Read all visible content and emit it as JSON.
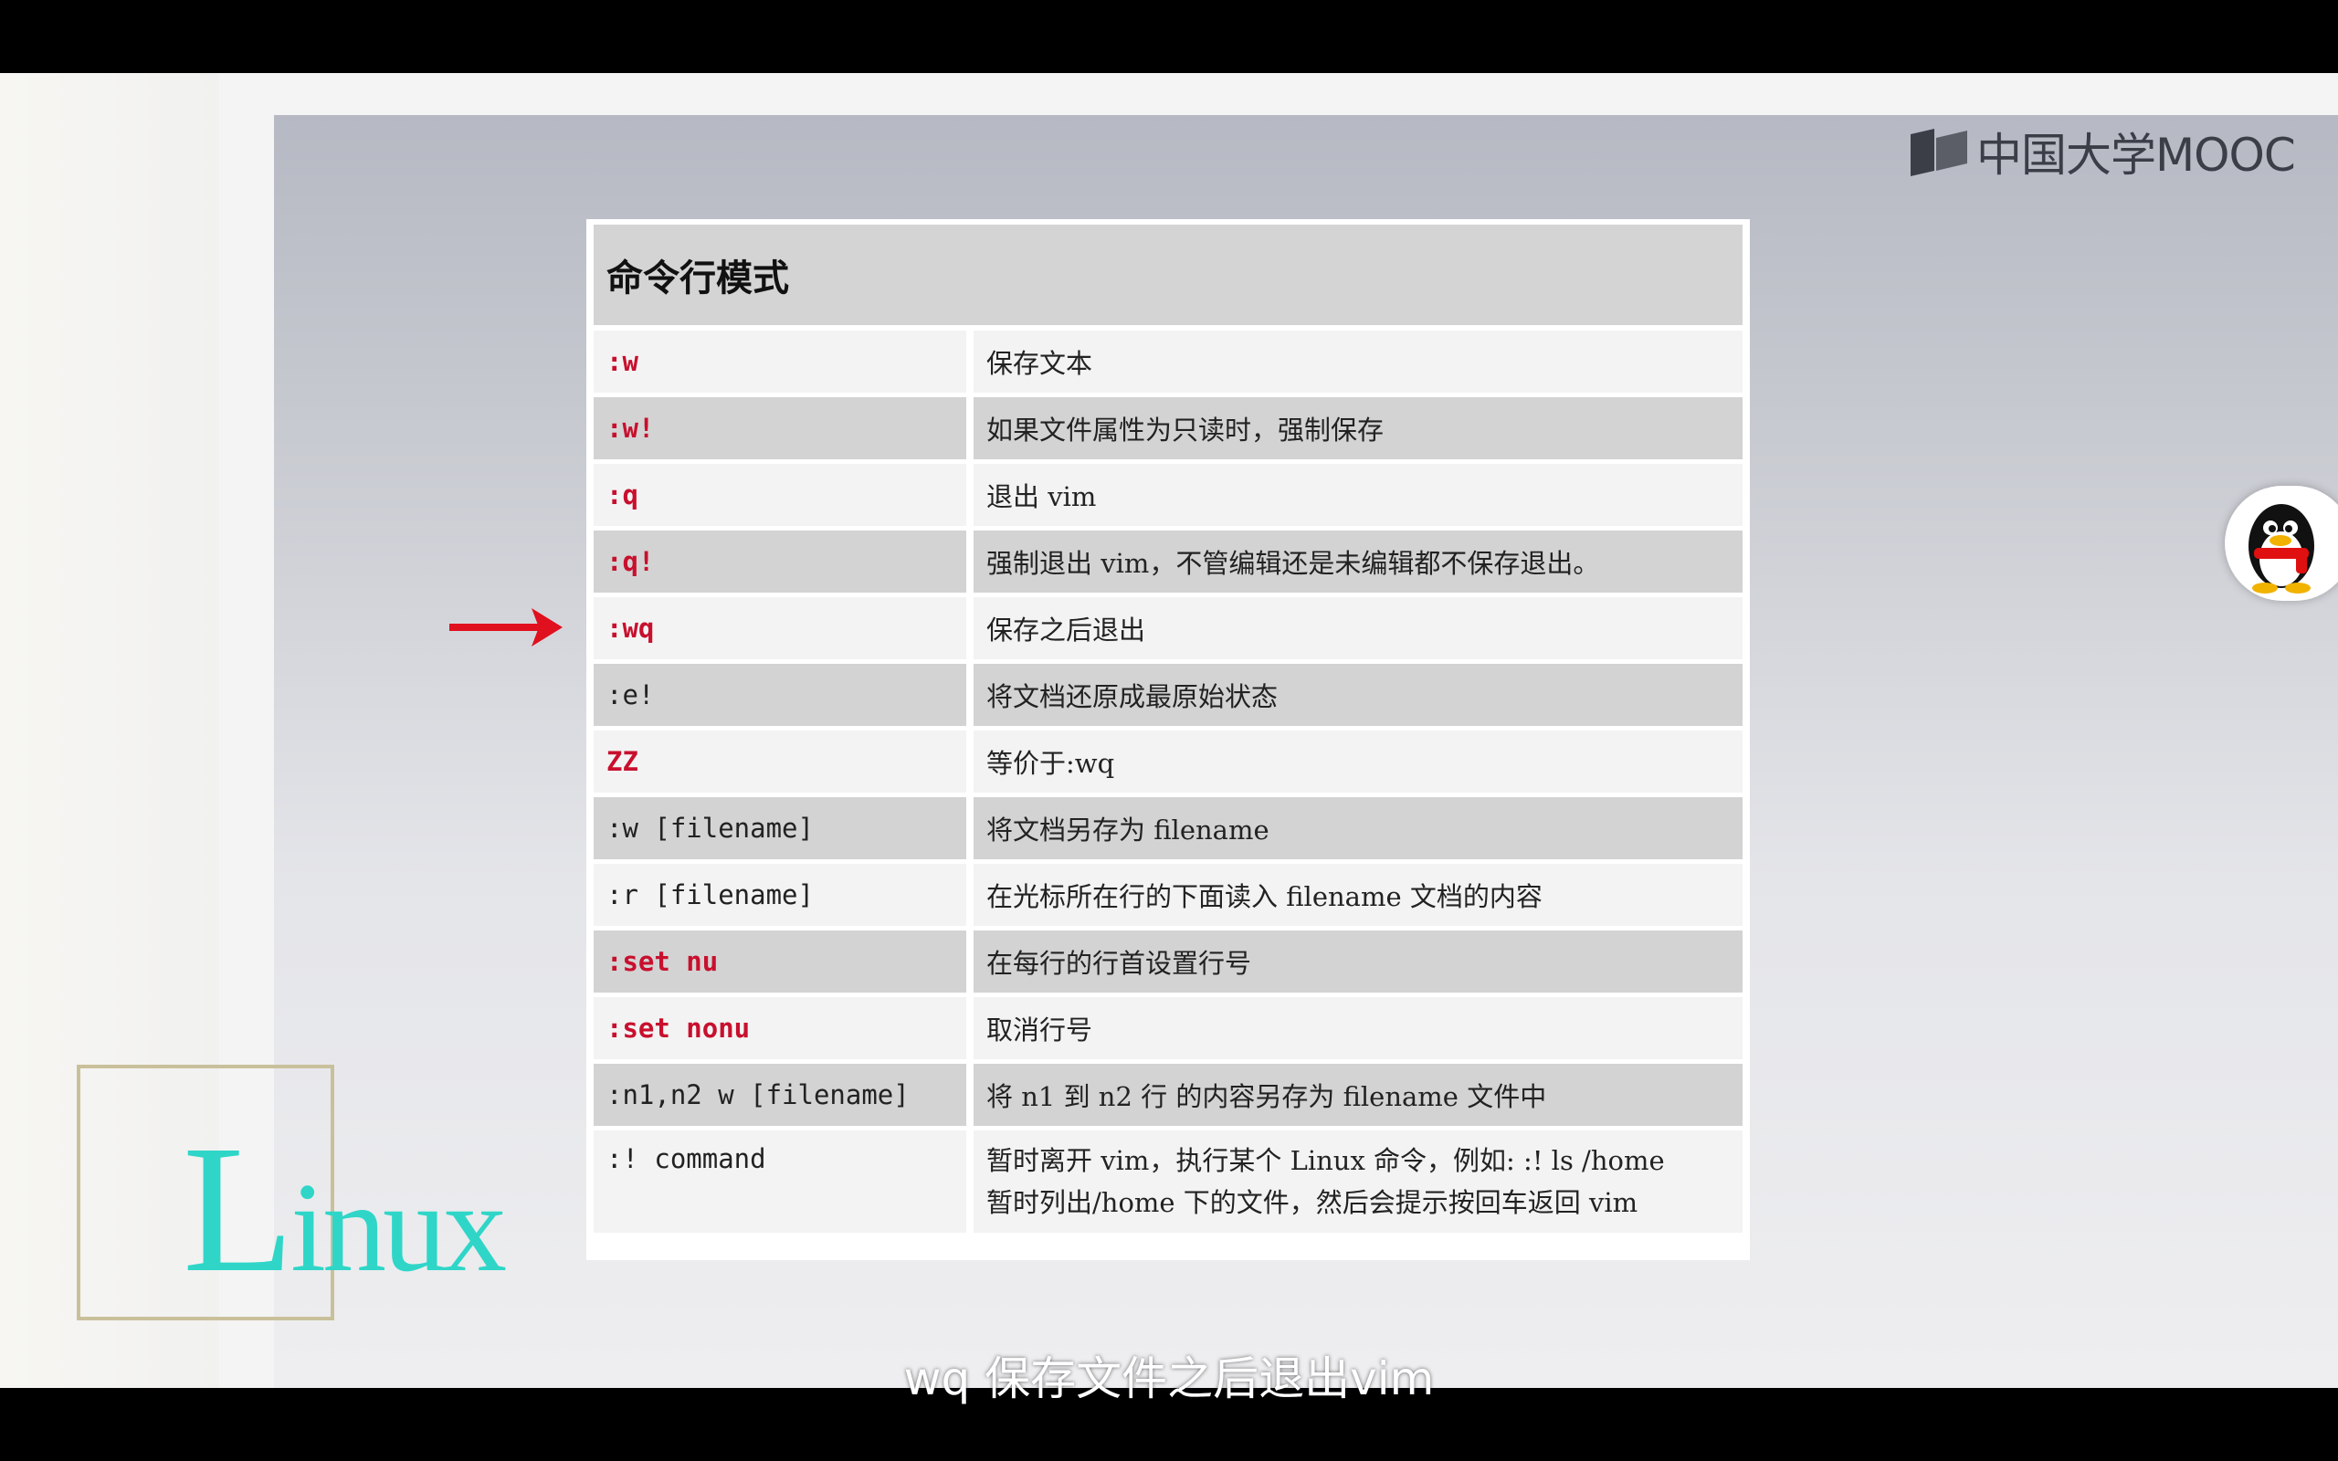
{
  "branding": {
    "logo_text": "中国大学MOOC"
  },
  "table": {
    "title": "命令行模式",
    "rows": [
      {
        "cmd": ":w",
        "desc": "保存文本",
        "cmd_red": true
      },
      {
        "cmd": ":w!",
        "desc": "如果文件属性为只读时，强制保存",
        "cmd_red": true
      },
      {
        "cmd": ":q",
        "desc": "退出 vim",
        "cmd_red": true
      },
      {
        "cmd": ":q!",
        "desc": "强制退出 vim，不管编辑还是未编辑都不保存退出。",
        "cmd_red": true
      },
      {
        "cmd": ":wq",
        "desc": "保存之后退出",
        "cmd_red": true
      },
      {
        "cmd": ":e!",
        "desc": "将文档还原成最原始状态",
        "cmd_red": false
      },
      {
        "cmd": "ZZ",
        "desc": "等价于:wq",
        "cmd_red": true
      },
      {
        "cmd": ":w  [filename]",
        "desc": "将文档另存为 filename",
        "cmd_red": false
      },
      {
        "cmd": ":r  [filename]",
        "desc": "在光标所在行的下面读入 filename 文档的内容",
        "cmd_red": false
      },
      {
        "cmd": ":set  nu",
        "desc": "在每行的行首设置行号",
        "cmd_red": true
      },
      {
        "cmd": ":set  nonu",
        "desc": "取消行号",
        "cmd_red": true
      },
      {
        "cmd": ":n1,n2 w [filename]",
        "desc": "将 n1 到 n2 行  的内容另存为 filename 文件中",
        "cmd_red": false
      },
      {
        "cmd": ":!  command",
        "desc": "暂时离开 vim，执行某个 Linux 命令，例如: :!  ls /home\n暂时列出/home 下的文件，然后会提示按回车返回 vim",
        "cmd_red": false
      }
    ]
  },
  "decor": {
    "linux_logo": "Linux",
    "highlight_arrow_row": ":wq",
    "qq_icon": "qq-penguin-icon"
  },
  "subtitle": "wq  保存文件之后退出vim",
  "colors": {
    "cmd_red": "#c8102e",
    "arrow_red": "#e0101e",
    "linux_teal": "#2fd6c8"
  }
}
